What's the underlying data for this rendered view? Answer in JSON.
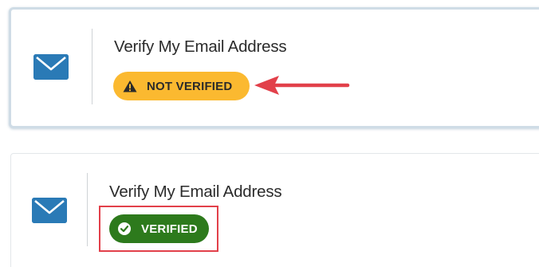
{
  "cards": [
    {
      "title": "Verify My Email Address",
      "badge": {
        "label": "NOT VERIFIED",
        "status": "warning",
        "icon": "warning-triangle-icon",
        "color": "#fbb930"
      }
    },
    {
      "title": "Verify My Email Address",
      "badge": {
        "label": "VERIFIED",
        "status": "success",
        "icon": "check-circle-icon",
        "color": "#2d7a1c"
      }
    }
  ],
  "icons": {
    "email": "envelope-icon"
  },
  "annotations": {
    "arrow": {
      "color": "#e2404a",
      "points_to": "NOT VERIFIED"
    },
    "highlight_box": {
      "color": "#e2404a",
      "surrounds": "VERIFIED"
    }
  }
}
